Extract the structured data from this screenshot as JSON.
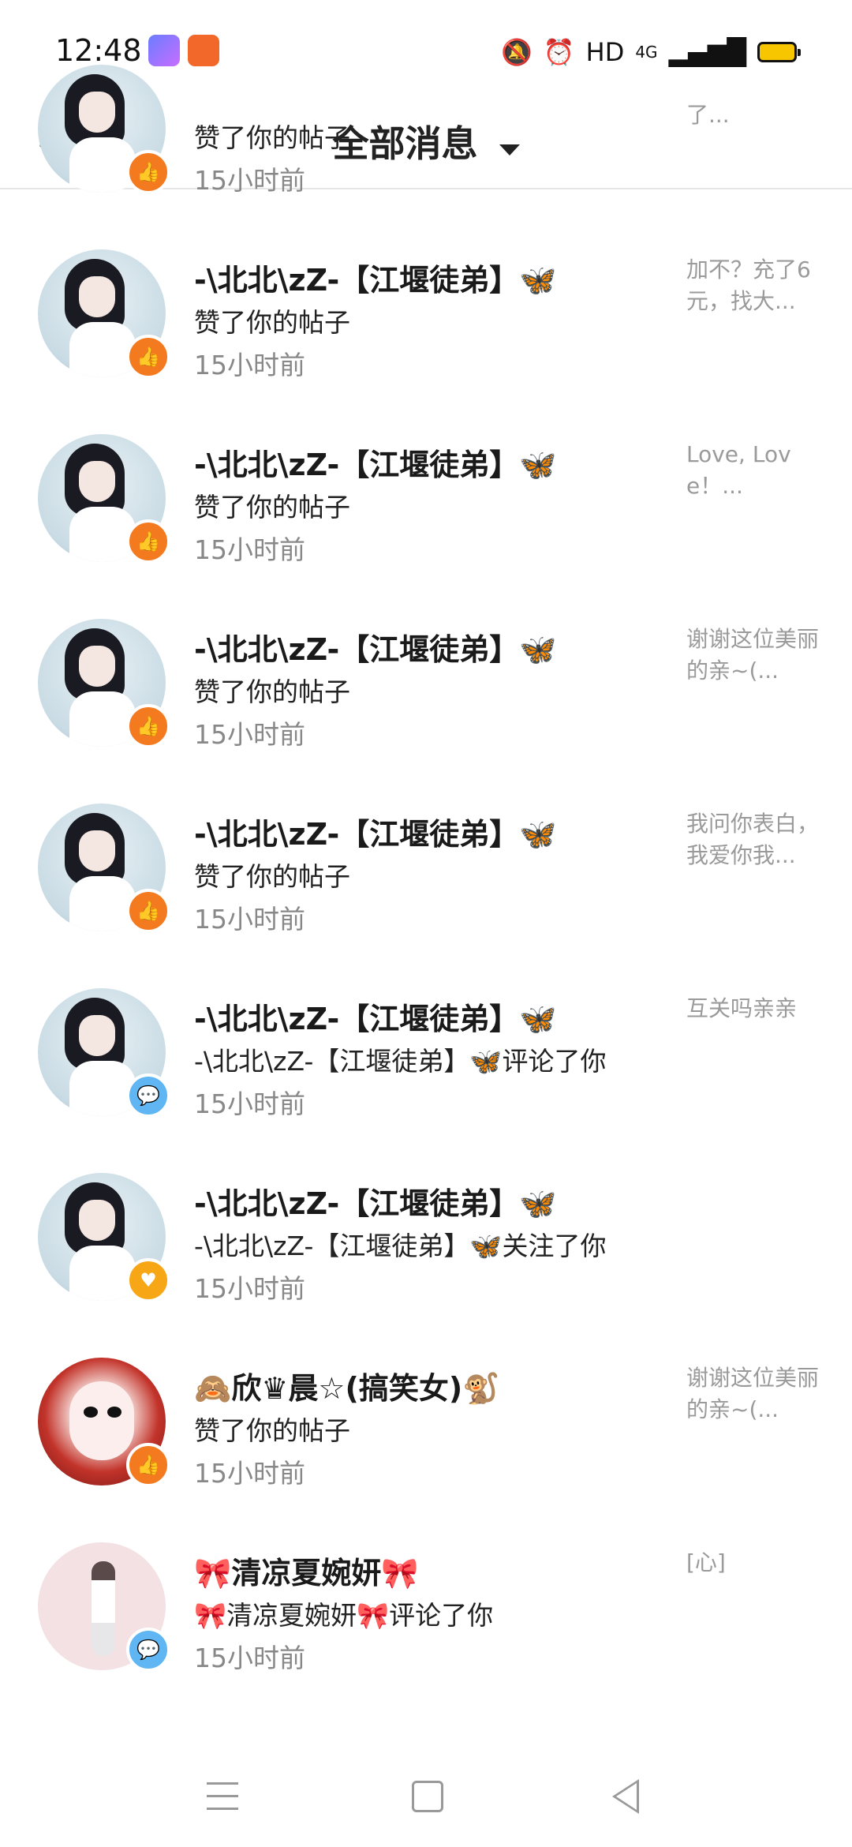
{
  "status_bar": {
    "time": "12:48",
    "app_icons": [
      "app-icon-1",
      "app-icon-2"
    ],
    "indicators": {
      "mute": "🔕",
      "alarm": "⏰",
      "hd": "HD",
      "network": "4G",
      "signal": "▂▄▆█"
    }
  },
  "header": {
    "back": "‹",
    "title": "全部消息"
  },
  "messages": [
    {
      "name": "",
      "action": "赞了你的帖子",
      "time": "15小时前",
      "preview": "了...",
      "type": "like"
    },
    {
      "name": "-\\北北\\zZ-【江堰徒弟】🦋",
      "action": "赞了你的帖子",
      "time": "15小时前",
      "preview": "加不？充了6元，找大...",
      "type": "like"
    },
    {
      "name": "-\\北北\\zZ-【江堰徒弟】🦋",
      "action": "赞了你的帖子",
      "time": "15小时前",
      "preview": "Love, Love！...",
      "type": "like"
    },
    {
      "name": "-\\北北\\zZ-【江堰徒弟】🦋",
      "action": "赞了你的帖子",
      "time": "15小时前",
      "preview": "谢谢这位美丽的亲~(...",
      "type": "like"
    },
    {
      "name": "-\\北北\\zZ-【江堰徒弟】🦋",
      "action": "赞了你的帖子",
      "time": "15小时前",
      "preview": "我问你表白，我爱你我...",
      "type": "like"
    },
    {
      "name": "-\\北北\\zZ-【江堰徒弟】🦋",
      "action": "-\\北北\\zZ-【江堰徒弟】🦋评论了你",
      "time": "15小时前",
      "preview": "互关吗亲亲",
      "type": "comment"
    },
    {
      "name": "-\\北北\\zZ-【江堰徒弟】🦋",
      "action": "-\\北北\\zZ-【江堰徒弟】🦋关注了你",
      "time": "15小时前",
      "preview": "",
      "type": "follow"
    },
    {
      "name": "🙈欣♛晨☆(搞笑女)🐒",
      "action": "赞了你的帖子",
      "time": "15小时前",
      "preview": "谢谢这位美丽的亲~(...",
      "type": "like"
    },
    {
      "name": "🎀清凉夏婉妍🎀",
      "action": "🎀清凉夏婉妍🎀评论了你",
      "time": "15小时前",
      "preview": "[心]",
      "type": "comment"
    }
  ],
  "badge_icons": {
    "like": "👍",
    "comment": "💬",
    "follow": "♥"
  },
  "colors": {
    "like_badge": "#f47a1f",
    "comment_badge": "#5fb6f2",
    "follow_badge": "#f7a616",
    "time_gray": "#888888",
    "preview_gray": "#9a9a9a"
  }
}
